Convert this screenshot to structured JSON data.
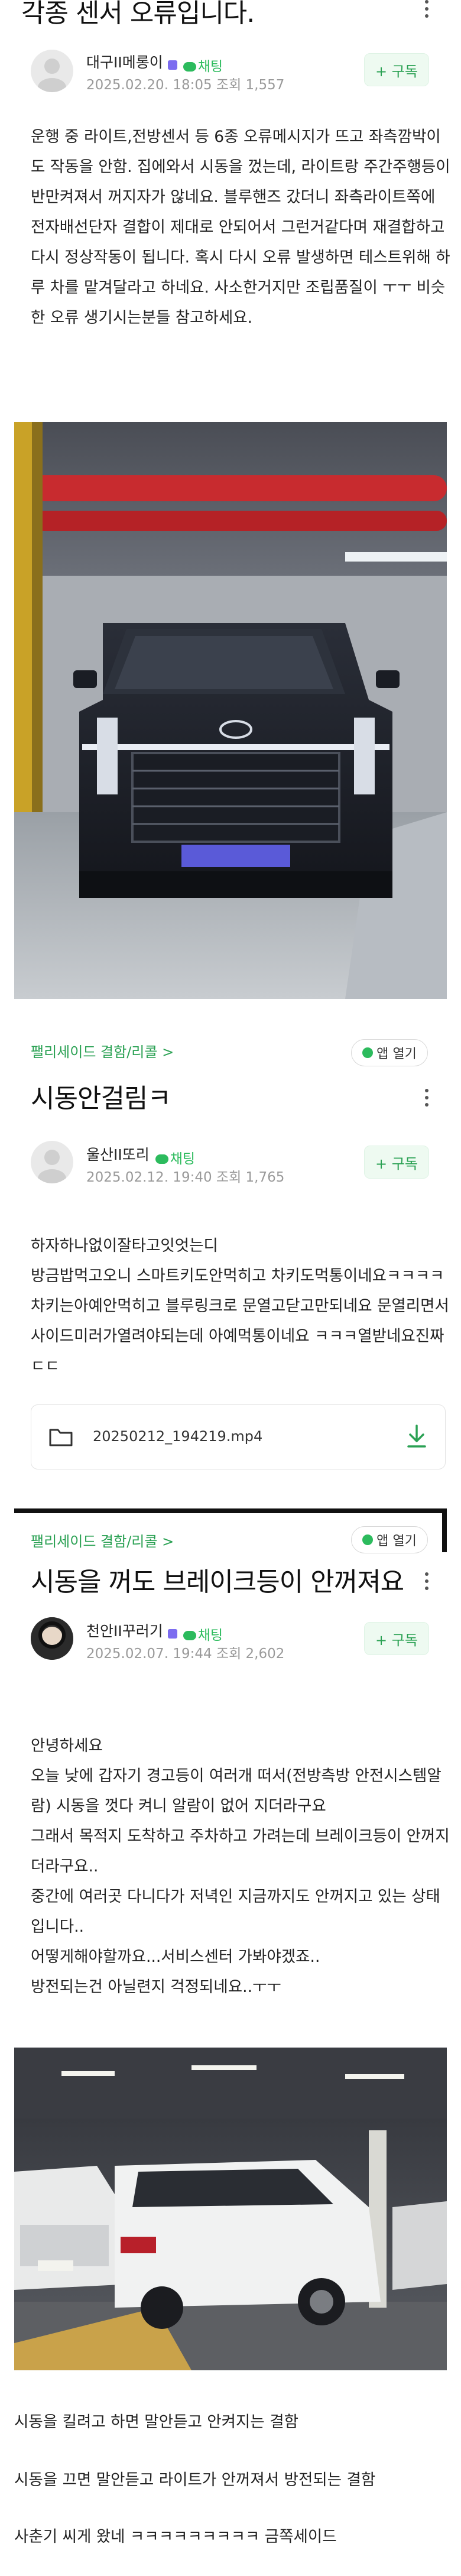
{
  "post1": {
    "title": "각종 센서 오류입니다.",
    "author": "대구II메롱이",
    "chat_label": "채팅",
    "meta": "2025.02.20. 18:05 조회 1,557",
    "subscribe_label": "+ 구독",
    "body": "운행 중 라이트,전방센서 등 6종 오류메시지가 뜨고 좌측깜박이도 작동을 안함. 집에와서 시동을 껐는데, 라이트랑 주간주행등이 반만켜져서 꺼지자가 않네요. 블루핸즈 갔더니 좌측라이트쪽에 전자배선단자 결합이 제대로 안되어서 그런거같다며 재결합하고 다시 정상작동이 됩니다. 혹시 다시 오류 발생하면 테스트위해 하루 차를 맡겨달라고 하네요. 사소한거지만 조립품질이 ㅜㅜ 비슷한 오류 생기시는분들 참고하세요."
  },
  "post2": {
    "breadcrumb": "팰리세이드 결함/리콜 >",
    "app_open_label": "앱 열기",
    "title": "시동안걸림ㅋ",
    "author": "울산II또리",
    "chat_label": "채팅",
    "meta": "2025.02.12. 19:40 조회 1,765",
    "subscribe_label": "+ 구독",
    "body": "하자하나없이잘타고잇엇는디\n방금밥먹고오니 스마트키도안먹히고 차키도먹통이네요ㅋㅋㅋㅋ차키는아예안먹히고 블루링크로 문열고닫고만되네요 문열리면서사이드미러가열려야되는데 아예먹통이네요 ㅋㅋㅋ열받네요진짜 ㄷㄷ",
    "attachment_name": "20250212_194219.mp4"
  },
  "post3": {
    "breadcrumb": "팰리세이드 결함/리콜 >",
    "app_open_label": "앱 열기",
    "title": "시동을 꺼도 브레이크등이 안꺼져요",
    "author": "천안II꾸러기",
    "chat_label": "채팅",
    "meta": "2025.02.07. 19:44 조회 2,602",
    "subscribe_label": "+ 구독",
    "body": "안녕하세요\n오늘 낮에 갑자기 경고등이 여러개 떠서(전방측방 안전시스템알람) 시동을 껏다 켜니 알람이 없어 지더라구요\n그래서 목적지 도착하고 주차하고 가려는데 브레이크등이 안꺼지더라구요..\n중간에 여러곳 다니다가 저녁인 지금까지도 안꺼지고 있는 상태입니다..\n어떻게해야할까요...서비스센터 가봐야겠죠..\n방전되는건 아닐련지 걱정되네요..ㅜㅜ"
  },
  "post4": {
    "line1": "시동을 킬려고 하면 말안듣고 안켜지는 결함",
    "line2": "시동을 끄면 말안듣고 라이트가 안꺼져서 방전되는 결함",
    "line3": "사춘기 씨게 왔네 ㅋㅋㅋㅋㅋㅋㅋㅋㅋ 금쪽세이드"
  },
  "icons": {
    "kebab": "more-vert-icon",
    "folder": "folder-icon",
    "download": "download-icon",
    "chat": "chat-bubble-icon"
  },
  "colors": {
    "accent_green": "#2aa153",
    "meta_gray": "#9a9a9a"
  }
}
